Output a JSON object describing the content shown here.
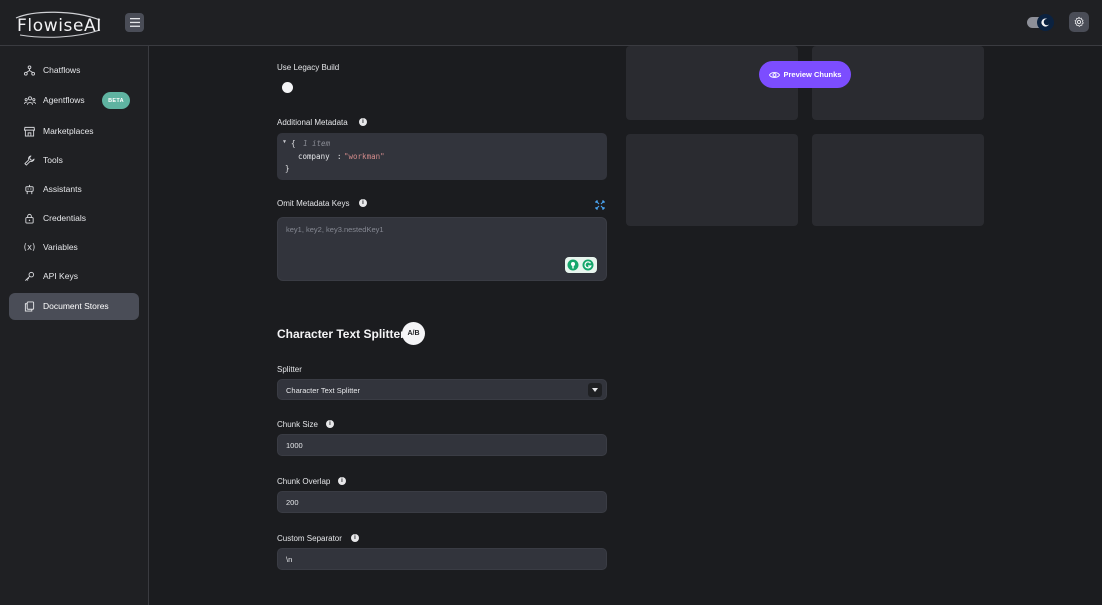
{
  "header": {
    "logo_text": "FlowiseAI"
  },
  "sidebar": {
    "items": [
      {
        "label": "Chatflows",
        "icon": "hierarchy-icon"
      },
      {
        "label": "Agentflows",
        "icon": "users-group-icon",
        "badge": "BETA"
      },
      {
        "label": "Marketplaces",
        "icon": "building-store-icon"
      },
      {
        "label": "Tools",
        "icon": "tool-icon"
      },
      {
        "label": "Assistants",
        "icon": "robot-icon"
      },
      {
        "label": "Credentials",
        "icon": "lock-icon"
      },
      {
        "label": "Variables",
        "icon": "variable-icon"
      },
      {
        "label": "API Keys",
        "icon": "key-icon"
      },
      {
        "label": "Document Stores",
        "icon": "files-icon",
        "active": true
      }
    ]
  },
  "form": {
    "legacy_build_label": "Use Legacy Build",
    "additional_metadata_label": "Additional Metadata",
    "metadata_json": {
      "open": "{",
      "count": "1 item",
      "key": "company",
      "colon": ":",
      "value": "\"workman\"",
      "close": "}"
    },
    "omit_keys_label": "Omit Metadata Keys",
    "omit_keys_placeholder": "key1, key2, key3.nestedKey1",
    "section_title": "Character Text Splitter",
    "section_icon_text": "A/B",
    "splitter_label": "Splitter",
    "splitter_value": "Character Text Splitter",
    "chunk_size_label": "Chunk Size",
    "chunk_size_value": "1000",
    "chunk_overlap_label": "Chunk Overlap",
    "chunk_overlap_value": "200",
    "custom_separator_label": "Custom Separator",
    "custom_separator_value": "\\n"
  },
  "preview": {
    "button_label": "Preview Chunks"
  },
  "colors": {
    "accent": "#7c4dff",
    "badge": "#5fb3a1",
    "background": "#1b1c1f",
    "panel": "#32343c"
  }
}
